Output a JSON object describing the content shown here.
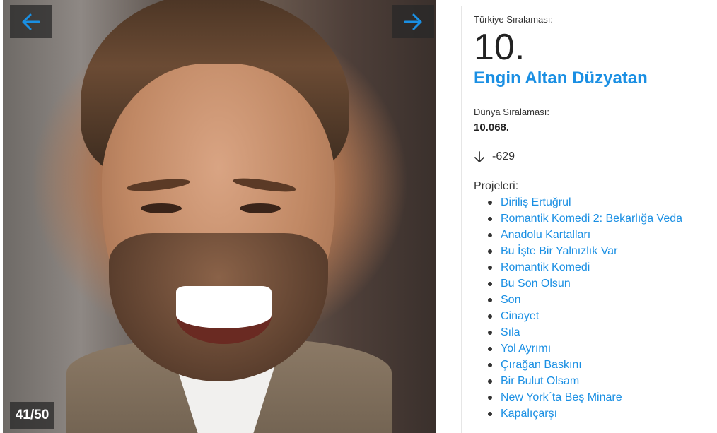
{
  "gallery": {
    "prev_icon": "arrow-left-icon",
    "next_icon": "arrow-right-icon",
    "counter": "41/50",
    "accent": "#1a8fe3"
  },
  "info": {
    "turkey_rank_label": "Türkiye Sıralaması:",
    "turkey_rank": "10.",
    "name": "Engin Altan Düzyatan",
    "world_rank_label": "Dünya Sıralaması:",
    "world_rank": "10.068.",
    "change_icon": "arrow-down-icon",
    "change": "-629",
    "projects_label": "Projeleri:",
    "projects": [
      "Diriliş Ertuğrul",
      "Romantik Komedi 2: Bekarlığa Veda",
      "Anadolu Kartalları",
      "Bu İşte Bir Yalnızlık Var",
      "Romantik Komedi",
      "Bu Son Olsun",
      "Son",
      "Cinayet",
      "Sıla",
      "Yol Ayrımı",
      "Çırağan Baskını",
      "Bir Bulut Olsam",
      "New York´ta Beş Minare",
      "Kapalıçarşı"
    ]
  }
}
